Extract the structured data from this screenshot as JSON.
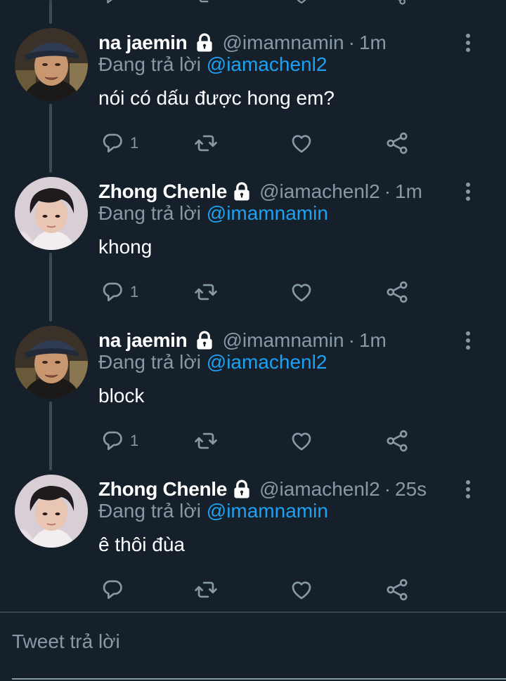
{
  "colors": {
    "background": "#15202b",
    "text_primary": "#ffffff",
    "text_secondary": "#8899a6",
    "mention": "#1da1f2",
    "thread_line": "#3d4a56",
    "divider": "#38444d"
  },
  "replying_prefix": "Đang trả lời",
  "icons": {
    "lock": "lock-icon",
    "more": "more-vertical-icon",
    "reply": "reply-icon",
    "retweet": "retweet-icon",
    "like": "heart-icon",
    "share": "share-icon"
  },
  "tweets": [
    {
      "name": "na jaemin",
      "handle": "@imamnamin",
      "separator": "·",
      "time": "1m",
      "replying_to": "@iamachenl2",
      "text": "nói có dấu được hong em?",
      "reply_count": "1",
      "avatar": "avatar-jaemin"
    },
    {
      "name": "Zhong Chenle",
      "handle": "@iamachenl2",
      "separator": "·",
      "time": "1m",
      "replying_to": "@imamnamin",
      "text": "khong",
      "reply_count": "1",
      "avatar": "avatar-chenle"
    },
    {
      "name": "na jaemin",
      "handle": "@imamnamin",
      "separator": "·",
      "time": "1m",
      "replying_to": "@iamachenl2",
      "text": "block",
      "reply_count": "1",
      "avatar": "avatar-jaemin"
    },
    {
      "name": "Zhong Chenle",
      "handle": "@iamachenl2",
      "separator": "·",
      "time": "25s",
      "replying_to": "@imamnamin",
      "text": "ê thôi đùa",
      "reply_count": "",
      "avatar": "avatar-chenle"
    }
  ],
  "composer": {
    "placeholder": "Tweet trả lời"
  }
}
